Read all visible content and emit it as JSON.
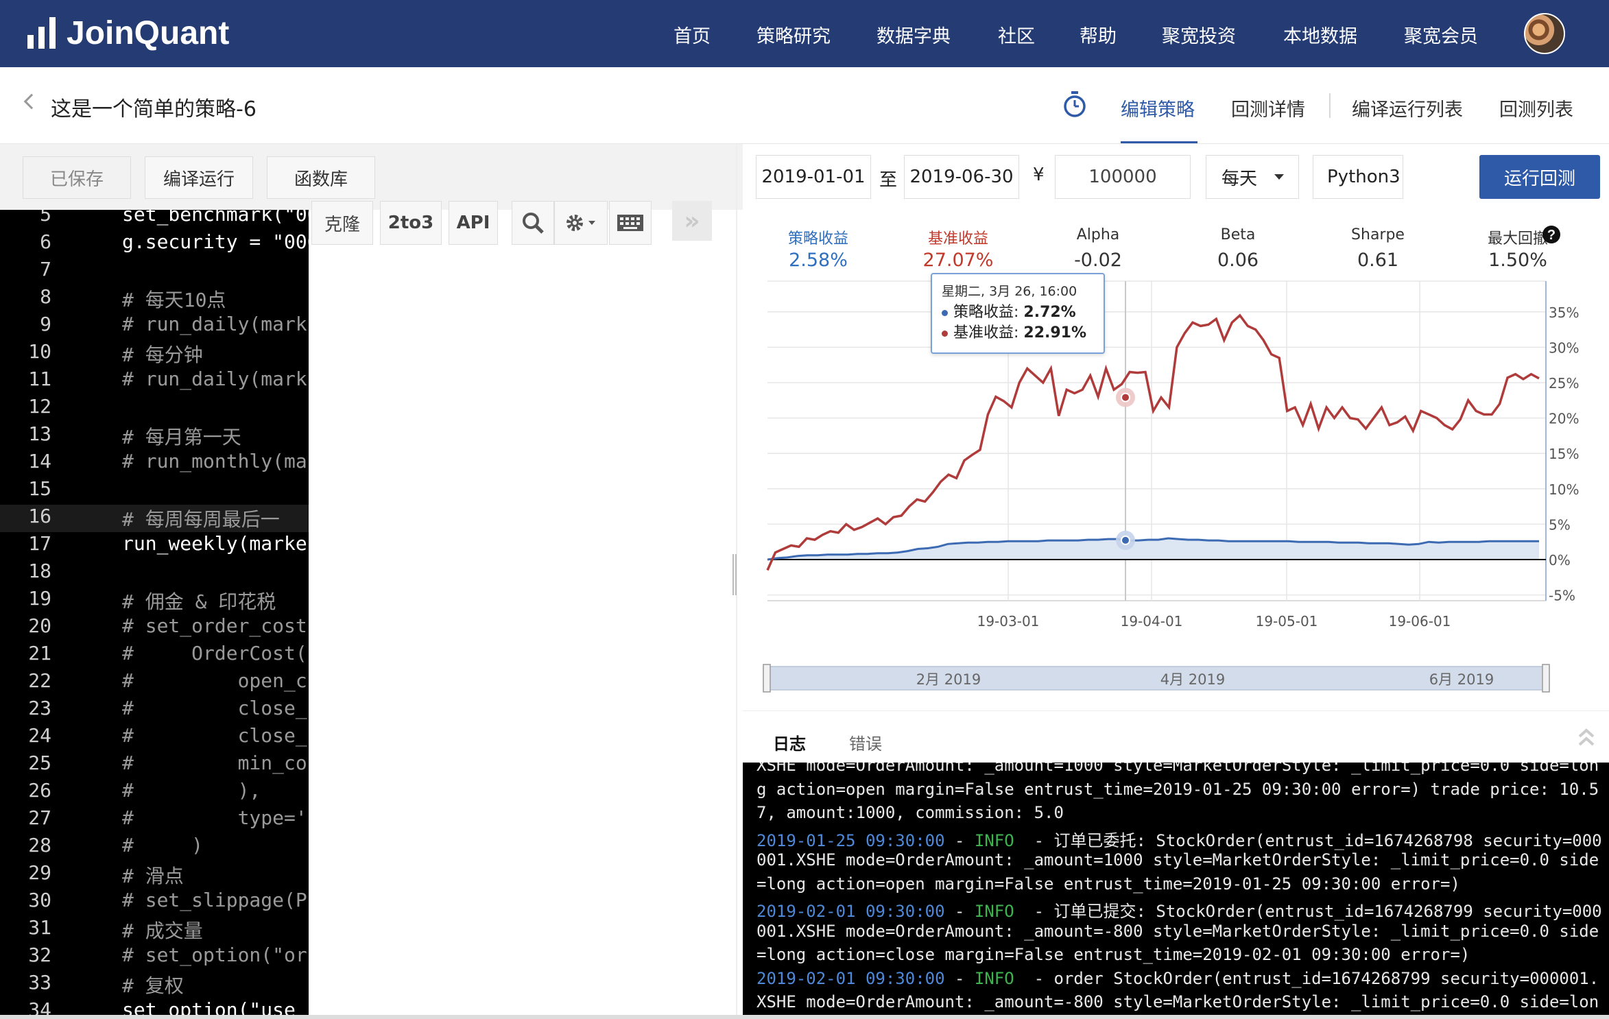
{
  "nav": {
    "logo": "JoinQuant",
    "items": [
      "首页",
      "策略研究",
      "数据字典",
      "社区",
      "帮助",
      "聚宽投资",
      "本地数据",
      "聚宽会员"
    ]
  },
  "title": {
    "strategy_name": "这是一个简单的策略-6",
    "tabs": [
      "编辑策略",
      "回测详情",
      "编译运行列表",
      "回测列表"
    ]
  },
  "left_toolbar": {
    "saved": "已保存",
    "compile_run": "编译运行",
    "func_lib": "函数库"
  },
  "editor_toolbar": {
    "clone": "克隆",
    "to3": "2to3",
    "api": "API",
    "collapse": "»"
  },
  "code_lines": [
    {
      "n": "5",
      "text": "set_benchmark(\"00",
      "type": "code"
    },
    {
      "n": "6",
      "text": "g.security = \"000",
      "type": "code"
    },
    {
      "n": "7",
      "text": "",
      "type": "code"
    },
    {
      "n": "8",
      "text": "# 每天10点",
      "type": "cmt"
    },
    {
      "n": "9",
      "text": "# run_daily(mark",
      "type": "cmt"
    },
    {
      "n": "10",
      "text": "# 每分钟",
      "type": "cmt"
    },
    {
      "n": "11",
      "text": "# run_daily(mark",
      "type": "cmt"
    },
    {
      "n": "12",
      "text": "",
      "type": "code"
    },
    {
      "n": "13",
      "text": "# 每月第一天",
      "type": "cmt"
    },
    {
      "n": "14",
      "text": "# run_monthly(ma",
      "type": "cmt"
    },
    {
      "n": "15",
      "text": "",
      "type": "code"
    },
    {
      "n": "16",
      "text": "# 每周每周最后一",
      "type": "cmt"
    },
    {
      "n": "17",
      "text": "run_weekly(marke",
      "type": "code"
    },
    {
      "n": "18",
      "text": "",
      "type": "code"
    },
    {
      "n": "19",
      "text": "# 佣金 & 印花税",
      "type": "cmt"
    },
    {
      "n": "20",
      "text": "# set_order_cost",
      "type": "cmt"
    },
    {
      "n": "21",
      "text": "#     OrderCost(",
      "type": "cmt"
    },
    {
      "n": "22",
      "text": "#         open_c",
      "type": "cmt"
    },
    {
      "n": "23",
      "text": "#         close_",
      "type": "cmt"
    },
    {
      "n": "24",
      "text": "#         close_",
      "type": "cmt"
    },
    {
      "n": "25",
      "text": "#         min_co",
      "type": "cmt"
    },
    {
      "n": "26",
      "text": "#         ),",
      "type": "cmt"
    },
    {
      "n": "27",
      "text": "#         type='",
      "type": "cmt"
    },
    {
      "n": "28",
      "text": "#     )",
      "type": "cmt"
    },
    {
      "n": "29",
      "text": "# 滑点",
      "type": "cmt"
    },
    {
      "n": "30",
      "text": "# set_slippage(P",
      "type": "cmt"
    },
    {
      "n": "31",
      "text": "# 成交量",
      "type": "cmt"
    },
    {
      "n": "32",
      "text": "# set_option(\"or",
      "type": "cmt"
    },
    {
      "n": "33",
      "text": "# 复权",
      "type": "cmt"
    },
    {
      "n": "34",
      "text": "set_option(\"use",
      "type": "code"
    }
  ],
  "settings": {
    "start_date": "2019-01-01",
    "to": "至",
    "end_date": "2019-06-30",
    "currency": "¥",
    "capital": "100000",
    "frequency": "每天",
    "python": "Python3",
    "run_button": "运行回测"
  },
  "stats": [
    {
      "label": "策略收益",
      "value": "2.58%",
      "color": "#2f6fc0"
    },
    {
      "label": "基准收益",
      "value": "27.07%",
      "color": "#c0392b"
    },
    {
      "label": "Alpha",
      "value": "-0.02",
      "color": "#333333"
    },
    {
      "label": "Beta",
      "value": "0.06",
      "color": "#333333"
    },
    {
      "label": "Sharpe",
      "value": "0.61",
      "color": "#333333"
    },
    {
      "label": "最大回撤",
      "value": "1.50%",
      "color": "#333333"
    }
  ],
  "tooltip": {
    "date": "星期二, 3月 26, 16:00",
    "strategy_label": "策略收益: ",
    "strategy_value": "2.72%",
    "bench_label": "基准收益: ",
    "bench_value": "22.91%"
  },
  "chart_data": {
    "type": "line",
    "ylim": [
      -5,
      36
    ],
    "y_ticks": [
      "35%",
      "30%",
      "25%",
      "20%",
      "15%",
      "10%",
      "5%",
      "0%",
      "-5%"
    ],
    "x_ticks": [
      "19-03-01",
      "19-04-01",
      "19-05-01",
      "19-06-01"
    ],
    "navigator_labels": [
      "2月 2019",
      "4月 2019",
      "6月 2019"
    ],
    "series": [
      {
        "name": "策略收益",
        "color": "#3d6bb3",
        "values": [
          0,
          0.2,
          0.3,
          0.5,
          0.6,
          0.6,
          0.7,
          0.7,
          0.7,
          0.8,
          0.8,
          0.9,
          0.9,
          1.0,
          1.2,
          1.5,
          1.6,
          1.8,
          2.2,
          2.3,
          2.4,
          2.4,
          2.5,
          2.5,
          2.6,
          2.6,
          2.6,
          2.6,
          2.7,
          2.7,
          2.7,
          2.7,
          2.8,
          2.8,
          2.9,
          2.9,
          2.7,
          2.7,
          2.8,
          2.8,
          3.0,
          2.9,
          2.8,
          2.8,
          2.7,
          2.7,
          2.6,
          2.6,
          2.6,
          2.6,
          2.6,
          2.6,
          2.6,
          2.5,
          2.5,
          2.5,
          2.5,
          2.4,
          2.4,
          2.4,
          2.3,
          2.3,
          2.3,
          2.2,
          2.1,
          2.2,
          2.5,
          2.4,
          2.5,
          2.5,
          2.5,
          2.5,
          2.6,
          2.6,
          2.6,
          2.6,
          2.6,
          2.6
        ]
      },
      {
        "name": "基准收益",
        "color": "#b03b3b",
        "values": [
          -1.5,
          1,
          1.5,
          2,
          1.8,
          3,
          2.8,
          3.5,
          4,
          3.8,
          5,
          4.2,
          4.6,
          5.2,
          5.8,
          5,
          6,
          6.2,
          7.5,
          8.5,
          8.2,
          9.5,
          11,
          12,
          11.5,
          14,
          14.8,
          15.5,
          20.5,
          23,
          22.4,
          21.5,
          25,
          27,
          26,
          25,
          27,
          20.3,
          24,
          23.5,
          24,
          26,
          23,
          27,
          24,
          24.8,
          26.5,
          26.4,
          26.5,
          21,
          22.9,
          21.5,
          30,
          32,
          33.5,
          33,
          33.2,
          34,
          31,
          33.5,
          34.5,
          33,
          32.5,
          31,
          29,
          28.5,
          21,
          21.5,
          19,
          22,
          18.5,
          21.5,
          20,
          21.5,
          20,
          19.8,
          18.5,
          20,
          21.5,
          19,
          19.4,
          20.2,
          18.2,
          21,
          20.5,
          20,
          19,
          18.4,
          19.8,
          22.5,
          21,
          20.5,
          20.5,
          22,
          25.7,
          26.2,
          25.5,
          26.2,
          25.6
        ]
      }
    ]
  },
  "log_tabs": [
    "日志",
    "错误"
  ],
  "log_lines": [
    [
      {
        "t": "XSHE mode=OrderAmount: _amount=1000 style=MarketOrderStyle: _limit_price=0.0 side=lon",
        "c": ""
      }
    ],
    [
      {
        "t": "g action=open margin=False entrust_time=2019-01-25 09:30:00 error=) trade price: 10.5",
        "c": ""
      }
    ],
    [
      {
        "t": "7, amount:1000, commission: 5.0",
        "c": ""
      }
    ],
    [
      {
        "t": "2019-01-25 09:30:00",
        "c": "ts"
      },
      {
        "t": " - ",
        "c": ""
      },
      {
        "t": "INFO",
        "c": "lv"
      },
      {
        "t": "  - 订单已委托: StockOrder(entrust_id=1674268798 security=000",
        "c": ""
      }
    ],
    [
      {
        "t": "001.XSHE mode=OrderAmount: _amount=1000 style=MarketOrderStyle: _limit_price=0.0 side",
        "c": ""
      }
    ],
    [
      {
        "t": "=long action=open margin=False entrust_time=2019-01-25 09:30:00 error=)",
        "c": ""
      }
    ],
    [
      {
        "t": "2019-02-01 09:30:00",
        "c": "ts"
      },
      {
        "t": " - ",
        "c": ""
      },
      {
        "t": "INFO",
        "c": "lv"
      },
      {
        "t": "  - 订单已提交: StockOrder(entrust_id=1674268799 security=000",
        "c": ""
      }
    ],
    [
      {
        "t": "001.XSHE mode=OrderAmount: _amount=-800 style=MarketOrderStyle: _limit_price=0.0 side",
        "c": ""
      }
    ],
    [
      {
        "t": "=long action=close margin=False entrust_time=2019-02-01 09:30:00 error=)",
        "c": ""
      }
    ],
    [
      {
        "t": "2019-02-01 09:30:00",
        "c": "ts"
      },
      {
        "t": " - ",
        "c": ""
      },
      {
        "t": "INFO",
        "c": "lv"
      },
      {
        "t": "  - order StockOrder(entrust_id=1674268799 security=000001.",
        "c": ""
      }
    ],
    [
      {
        "t": "XSHE mode=OrderAmount: _amount=-800 style=MarketOrderStyle: _limit_price=0.0 side=lon",
        "c": ""
      }
    ]
  ]
}
